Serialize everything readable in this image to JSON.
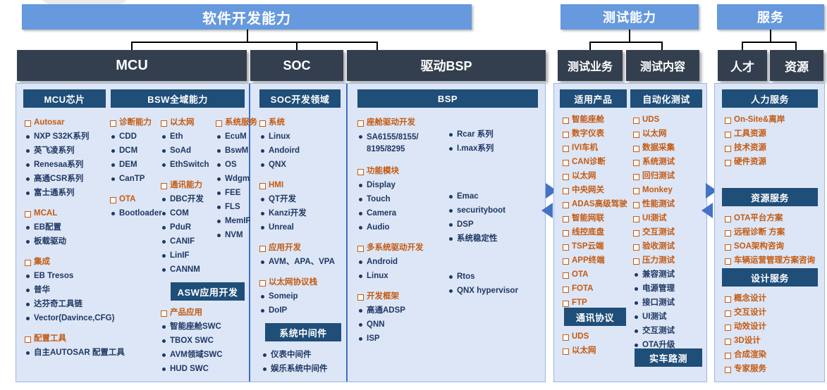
{
  "banners": {
    "software": "软件开发能力",
    "testing": "测试能力",
    "service": "服务"
  },
  "level2": {
    "mcu": "MCU",
    "soc": "SOC",
    "bsp": "驱动BSP",
    "test_business": "测试业务",
    "test_content": "测试内容",
    "talent": "人才",
    "resource": "资源"
  },
  "sections": {
    "mcu_chip": {
      "title": "MCU芯片"
    },
    "bsw": {
      "title": "BSW全域能力"
    },
    "asw": {
      "title": "ASW应用开发"
    },
    "soc_domain": {
      "title": "SOC开发领域"
    },
    "sys_middleware": {
      "title": "系统中间件"
    },
    "bsp": {
      "title": "BSP"
    },
    "applicable_products": {
      "title": "适用产品"
    },
    "auto_test": {
      "title": "自动化测试"
    },
    "comm_protocol": {
      "title": "通讯协议"
    },
    "real_vehicle": {
      "title": "实车路测"
    },
    "hr_service": {
      "title": "人力服务"
    },
    "resource_service": {
      "title": "资源服务"
    },
    "design_service": {
      "title": "设计服务"
    }
  },
  "lists": {
    "mcu_chip": [
      {
        "type": "sq",
        "label": "Autosar"
      },
      {
        "type": "rd",
        "label": "NXP S32K系列"
      },
      {
        "type": "rd",
        "label": "英飞凌系列"
      },
      {
        "type": "rd",
        "label": "Renesaa系列"
      },
      {
        "type": "rd",
        "label": "高通CSR系列"
      },
      {
        "type": "rd",
        "label": "富士通系列"
      },
      {
        "type": "gap"
      },
      {
        "type": "sq",
        "label": "MCAL"
      },
      {
        "type": "rd",
        "label": "EB配置"
      },
      {
        "type": "rd",
        "label": "板载驱动"
      },
      {
        "type": "gap"
      },
      {
        "type": "sq",
        "label": "集成"
      },
      {
        "type": "rd",
        "label": "EB Tresos"
      },
      {
        "type": "rd",
        "label": "普华"
      },
      {
        "type": "rd",
        "label": "达芬奇工具链"
      },
      {
        "type": "rd",
        "label": "Vector(Davince,CFG)"
      },
      {
        "type": "gap"
      },
      {
        "type": "sq",
        "label": "配置工具"
      },
      {
        "type": "rd",
        "label": "自主AUTOSAR 配置工具"
      }
    ],
    "bsw_col1": [
      {
        "type": "sq",
        "label": "诊断能力"
      },
      {
        "type": "rd",
        "label": "CDD"
      },
      {
        "type": "rd",
        "label": "DCM"
      },
      {
        "type": "rd",
        "label": "DEM"
      },
      {
        "type": "rd",
        "label": "CanTP"
      },
      {
        "type": "gap"
      },
      {
        "type": "sq",
        "label": "OTA"
      },
      {
        "type": "rd",
        "label": "Bootloader"
      }
    ],
    "bsw_col2": [
      {
        "type": "sq",
        "label": "以太网"
      },
      {
        "type": "rd",
        "label": "Eth"
      },
      {
        "type": "rd",
        "label": "SoAd"
      },
      {
        "type": "rd",
        "label": "EthSwitch"
      },
      {
        "type": "gap"
      },
      {
        "type": "sq",
        "label": "通讯能力"
      },
      {
        "type": "rd",
        "label": "DBC开发"
      },
      {
        "type": "rd",
        "label": "COM"
      },
      {
        "type": "rd",
        "label": "PduR"
      },
      {
        "type": "rd",
        "label": "CANIF"
      },
      {
        "type": "rd",
        "label": "LinIF"
      },
      {
        "type": "rd",
        "label": "CANNM"
      }
    ],
    "bsw_col3": [
      {
        "type": "sq",
        "label": "系统服务"
      },
      {
        "type": "rd",
        "label": "EcuM"
      },
      {
        "type": "rd",
        "label": "BswM"
      },
      {
        "type": "rd",
        "label": "OS"
      },
      {
        "type": "rd",
        "label": "Wdgm"
      },
      {
        "type": "rd",
        "label": "FEE"
      },
      {
        "type": "rd",
        "label": "FLS"
      },
      {
        "type": "rd",
        "label": "MemIF"
      },
      {
        "type": "rd",
        "label": "NVM"
      }
    ],
    "asw": [
      {
        "type": "sq",
        "label": "产品应用"
      },
      {
        "type": "rd",
        "label": "智能座舱SWC"
      },
      {
        "type": "rd",
        "label": "TBOX SWC"
      },
      {
        "type": "rd",
        "label": "AVM领域SWC"
      },
      {
        "type": "rd",
        "label": "HUD SWC"
      }
    ],
    "soc_domain": [
      {
        "type": "sq",
        "label": "系统"
      },
      {
        "type": "rd",
        "label": "Linux"
      },
      {
        "type": "rd",
        "label": "Andoird"
      },
      {
        "type": "rd",
        "label": "QNX"
      },
      {
        "type": "gap"
      },
      {
        "type": "sq",
        "label": "HMI"
      },
      {
        "type": "rd",
        "label": "QT开发"
      },
      {
        "type": "rd",
        "label": "Kanzi开发"
      },
      {
        "type": "rd",
        "label": "Unreal"
      },
      {
        "type": "gap"
      },
      {
        "type": "sq",
        "label": "应用开发"
      },
      {
        "type": "rd",
        "label": "AVM、APA、VPA"
      },
      {
        "type": "gap"
      },
      {
        "type": "sq",
        "label": "以太网协议栈"
      },
      {
        "type": "rd",
        "label": "Someip"
      },
      {
        "type": "rd",
        "label": "DoIP"
      }
    ],
    "sys_middleware": [
      {
        "type": "rd",
        "label": "仪表中间件"
      },
      {
        "type": "rd",
        "label": "娱乐系统中间件"
      }
    ],
    "bsp_col1": [
      {
        "type": "sq",
        "label": "座舱驱动开发"
      },
      {
        "type": "rd",
        "label": "SA6155/8155/ 8195/8295",
        "wrap": true
      },
      {
        "type": "gap"
      },
      {
        "type": "sq",
        "label": "功能模块"
      },
      {
        "type": "rd",
        "label": "Display"
      },
      {
        "type": "rd",
        "label": "Touch"
      },
      {
        "type": "rd",
        "label": "Camera"
      },
      {
        "type": "rd",
        "label": "Audio"
      },
      {
        "type": "gap"
      },
      {
        "type": "sq",
        "label": "多系统驱动开发"
      },
      {
        "type": "rd",
        "label": "Android"
      },
      {
        "type": "rd",
        "label": "Linux"
      },
      {
        "type": "gap"
      },
      {
        "type": "sq",
        "label": "开发框架"
      },
      {
        "type": "rd",
        "label": "高通ADSP"
      },
      {
        "type": "rd",
        "label": "QNN"
      },
      {
        "type": "rd",
        "label": "ISP"
      }
    ],
    "bsp_col2_a": [
      {
        "type": "rd",
        "label": "Rcar 系列"
      },
      {
        "type": "rd",
        "label": "I.max系列"
      }
    ],
    "bsp_col2_b": [
      {
        "type": "rd",
        "label": "Emac"
      },
      {
        "type": "rd",
        "label": "securityboot"
      },
      {
        "type": "rd",
        "label": "DSP"
      },
      {
        "type": "rd",
        "label": "系统稳定性"
      }
    ],
    "bsp_col2_c": [
      {
        "type": "rd",
        "label": "Rtos"
      },
      {
        "type": "rd",
        "label": "QNX hypervisor"
      }
    ],
    "applicable_products": [
      {
        "type": "sq",
        "label": "智能座舱"
      },
      {
        "type": "sq",
        "label": "数字仪表"
      },
      {
        "type": "sq",
        "label": "IVI车机"
      },
      {
        "type": "sq",
        "label": "CAN诊断"
      },
      {
        "type": "sq",
        "label": "以太网"
      },
      {
        "type": "sq",
        "label": "中央网关"
      },
      {
        "type": "sq",
        "label": "ADAS高级驾驶"
      },
      {
        "type": "sq",
        "label": "智能网联"
      },
      {
        "type": "sq",
        "label": "线控底盘"
      },
      {
        "type": "sq",
        "label": "TSP云端"
      },
      {
        "type": "sq",
        "label": "APP终端"
      },
      {
        "type": "sq",
        "label": "OTA"
      },
      {
        "type": "sq",
        "label": "FOTA"
      },
      {
        "type": "sq",
        "label": "FTP"
      }
    ],
    "comm_protocol": [
      {
        "type": "sq",
        "label": "UDS"
      },
      {
        "type": "sq",
        "label": "以太网"
      }
    ],
    "auto_test": [
      {
        "type": "sq",
        "label": "UDS"
      },
      {
        "type": "sq",
        "label": "以太网"
      },
      {
        "type": "sq",
        "label": "数据采集"
      },
      {
        "type": "sq",
        "label": "系统测试"
      },
      {
        "type": "sq",
        "label": "回归测试"
      },
      {
        "type": "sq",
        "label": "Monkey"
      },
      {
        "type": "sq",
        "label": "性能测试"
      },
      {
        "type": "sq",
        "label": "UI测试"
      },
      {
        "type": "sq",
        "label": "交互测试"
      },
      {
        "type": "sq",
        "label": "验收测试"
      },
      {
        "type": "sq",
        "label": "压力测试"
      },
      {
        "type": "rd",
        "label": "兼容测试"
      },
      {
        "type": "rd",
        "label": "电源管理"
      },
      {
        "type": "rd",
        "label": "接口测试"
      },
      {
        "type": "rd",
        "label": "UI测试"
      },
      {
        "type": "rd",
        "label": "交互测试"
      },
      {
        "type": "rd",
        "label": "OTA升级"
      }
    ],
    "hr_service": [
      {
        "type": "sq",
        "label": "On-Site&离岸"
      },
      {
        "type": "sq",
        "label": "工具资源"
      },
      {
        "type": "sq",
        "label": "技术资源"
      },
      {
        "type": "sq",
        "label": "硬件资源"
      }
    ],
    "resource_service": [
      {
        "type": "sq",
        "label": "OTA平台方案"
      },
      {
        "type": "sq",
        "label": "远程诊断 方案"
      },
      {
        "type": "sq",
        "label": "SOA架构咨询"
      },
      {
        "type": "sq",
        "label": "车辆运营管理方案咨询"
      }
    ],
    "design_service": [
      {
        "type": "sq",
        "label": "概念设计"
      },
      {
        "type": "sq",
        "label": "交互设计"
      },
      {
        "type": "sq",
        "label": "动效设计"
      },
      {
        "type": "sq",
        "label": "3D设计"
      },
      {
        "type": "sq",
        "label": "合成渲染"
      },
      {
        "type": "sq",
        "label": "专家服务"
      }
    ]
  },
  "colors": {
    "banner": "#6699DD",
    "level2": "#333F4F",
    "panel_bg": "#DCE6F6",
    "section_head": "#1F4E79",
    "heading_text": "#C55A11",
    "item_text": "#1F3864",
    "arrow": "#4472C4"
  }
}
